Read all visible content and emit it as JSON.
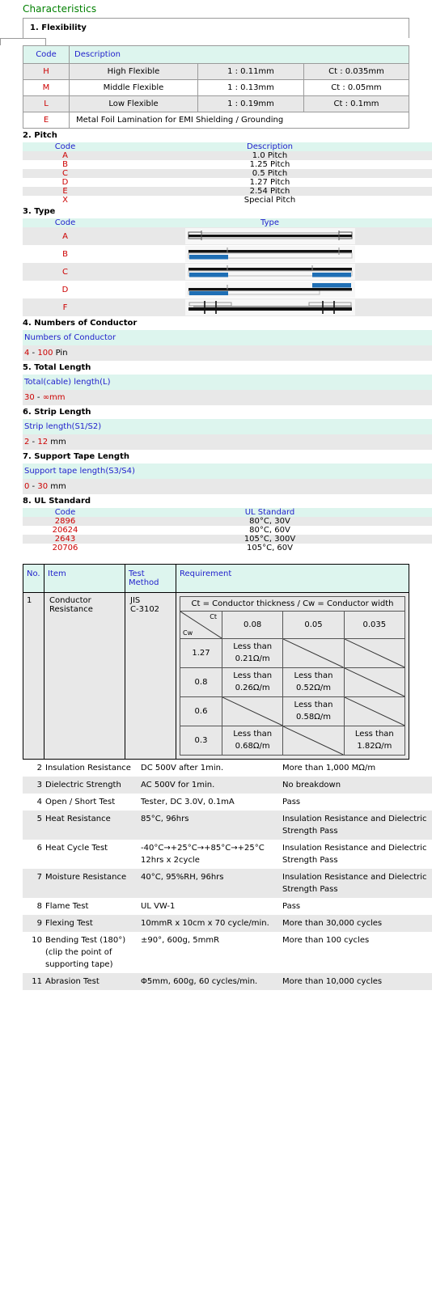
{
  "document": {
    "title": "Characteristics"
  },
  "flexibility": {
    "heading": "1. Flexibility",
    "columns": [
      "Code",
      "Description",
      "",
      ""
    ],
    "rows": [
      {
        "code": "H",
        "description": "High Flexible",
        "ratio": "1 : 0.11mm",
        "ct": "Ct : 0.035mm"
      },
      {
        "code": "M",
        "description": "Middle Flexible",
        "ratio": "1 : 0.13mm",
        "ct": "Ct : 0.05mm"
      },
      {
        "code": "L",
        "description": "Low Flexible",
        "ratio": "1 : 0.19mm",
        "ct": "Ct : 0.1mm"
      }
    ],
    "full_row": {
      "code": "E",
      "description": "Metal Foil Lamination for EMI Shielding / Grounding"
    }
  },
  "pitch": {
    "heading": "2. Pitch",
    "columns": [
      "Code",
      "Description"
    ],
    "rows": [
      {
        "code": "A",
        "description": "1.0 Pitch"
      },
      {
        "code": "B",
        "description": "1.25 Pitch"
      },
      {
        "code": "C",
        "description": "0.5 Pitch"
      },
      {
        "code": "D",
        "description": "1.27 Pitch"
      },
      {
        "code": "E",
        "description": "2.54 Pitch"
      },
      {
        "code": "X",
        "description": "Special Pitch"
      }
    ]
  },
  "type": {
    "heading": "3. Type",
    "columns": [
      "Code",
      "Type"
    ],
    "rows": [
      {
        "code": "A",
        "diagram": "cable-plain-both-ends"
      },
      {
        "code": "B",
        "diagram": "cable-tape-left-bottom"
      },
      {
        "code": "C",
        "diagram": "cable-tape-both-bottom"
      },
      {
        "code": "D",
        "diagram": "cable-tape-opposite-sides"
      },
      {
        "code": "F",
        "diagram": "cable-reinforced-both-ends"
      }
    ]
  },
  "conductors": {
    "heading": "4. Numbers of Conductor",
    "field_label": "Numbers of Conductor",
    "min": "4",
    "sep": " - ",
    "max": "100",
    "unit": " Pin"
  },
  "total_length": {
    "heading": "5. Total Length",
    "field_label": "Total(cable) length(L)",
    "min": "30",
    "sep": " - ",
    "max": "∞",
    "unit": "mm"
  },
  "strip_length": {
    "heading": "6. Strip Length",
    "field_label": "Strip length(S1/S2)",
    "min": "2",
    "sep": " - ",
    "max": "12",
    "unit": " mm"
  },
  "support_tape": {
    "heading": "7. Support Tape Length",
    "field_label": "Support tape length(S3/S4)",
    "min": "0",
    "sep": " - ",
    "max": "30",
    "unit": " mm"
  },
  "ul_standard": {
    "heading": "8. UL Standard",
    "columns": [
      "Code",
      "UL Standard"
    ],
    "rows": [
      {
        "code": "2896",
        "standard": "80°C, 30V"
      },
      {
        "code": "20624",
        "standard": "80°C, 60V"
      },
      {
        "code": "2643",
        "standard": "105°C, 300V"
      },
      {
        "code": "20706",
        "standard": "105°C, 60V"
      }
    ]
  },
  "requirements": {
    "columns": [
      "No.",
      "Item",
      "Test\nMethod",
      "Requirement"
    ],
    "col_no": "No.",
    "col_item": "Item",
    "col_method_line1": "Test",
    "col_method_line2": "Method",
    "col_requirement": "Requirement",
    "resistance_row": {
      "no": "1",
      "item_line1": "Conductor",
      "item_line2": "Resistance",
      "method_line1": "JIS",
      "method_line2": "C-3102",
      "matrix": {
        "caption": "Ct = Conductor thickness / Cw = Conductor width",
        "corner_col": "Ct",
        "corner_row": "Cw",
        "ct_values": [
          "0.08",
          "0.05",
          "0.035"
        ],
        "cw_values": [
          "1.27",
          "0.8",
          "0.6",
          "0.3"
        ],
        "cells": [
          [
            {
              "prefix": "Less than",
              "value": "0.21Ω/m"
            },
            {
              "prefix": "",
              "value": ""
            },
            {
              "prefix": "",
              "value": ""
            }
          ],
          [
            {
              "prefix": "Less than",
              "value": "0.26Ω/m"
            },
            {
              "prefix": "Less than",
              "value": "0.52Ω/m"
            },
            {
              "prefix": "",
              "value": ""
            }
          ],
          [
            {
              "prefix": "",
              "value": ""
            },
            {
              "prefix": "Less than",
              "value": "0.58Ω/m"
            },
            {
              "prefix": "",
              "value": ""
            }
          ],
          [
            {
              "prefix": "Less than",
              "value": "0.68Ω/m"
            },
            {
              "prefix": "",
              "value": ""
            },
            {
              "prefix": "Less than",
              "value": "1.82Ω/m"
            }
          ]
        ]
      }
    },
    "tests": [
      {
        "no": "2",
        "item": "Insulation Resistance",
        "method": "DC 500V after 1min.",
        "requirement": "More than 1,000 MΩ/m"
      },
      {
        "no": "3",
        "item": "Dielectric Strength",
        "method": "AC 500V for 1min.",
        "requirement": "No breakdown"
      },
      {
        "no": "4",
        "item": "Open / Short Test",
        "method": "Tester, DC 3.0V, 0.1mA",
        "requirement": "Pass"
      },
      {
        "no": "5",
        "item": "Heat Resistance",
        "method": "85°C, 96hrs",
        "requirement": "Insulation Resistance and Dielectric Strength Pass"
      },
      {
        "no": "6",
        "item": "Heat Cycle Test",
        "method": "-40°C→+25°C→+85°C→+25°C 12hrs x 2cycle",
        "requirement": "Insulation Resistance and Dielectric Strength Pass"
      },
      {
        "no": "7",
        "item": "Moisture Resistance",
        "method": "40°C, 95%RH, 96hrs",
        "requirement": "Insulation Resistance and Dielectric Strength Pass"
      },
      {
        "no": "8",
        "item": "Flame Test",
        "method": "UL VW-1",
        "requirement": "Pass"
      },
      {
        "no": "9",
        "item": "Flexing Test",
        "method": "10mmR x 10cm x 70 cycle/min.",
        "requirement": "More than 30,000 cycles"
      },
      {
        "no": "10",
        "item": "Bending Test (180°) (clip the point of supporting tape)",
        "method": "±90°, 600g, 5mmR",
        "requirement": "More than 100 cycles"
      },
      {
        "no": "11",
        "item": "Abrasion Test",
        "method": "Φ5mm, 600g, 60 cycles/min.",
        "requirement": "More than 10,000 cycles"
      }
    ]
  },
  "colors": {
    "title_green": "#008000",
    "header_blue": "#2222CC",
    "code_red": "#CC0000",
    "header_bg": "#DDF5EE",
    "stripe_bg": "#E8E8E8",
    "tape_blue": "#1F6FB5"
  }
}
